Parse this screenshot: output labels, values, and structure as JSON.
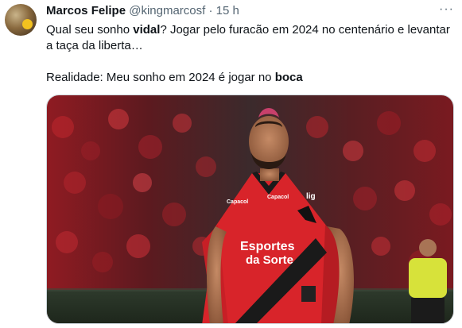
{
  "author": {
    "name": "Marcos Felipe",
    "handle": "@kingmarcosf",
    "separator": "·",
    "time": "15 h"
  },
  "more_icon": "more-horizontal-icon",
  "tweet": {
    "line1_pre": "Qual seu sonho ",
    "line1_bold": "vidal",
    "line1_post": "? Jogar pelo furacão em 2024 no centenário e levantar a taça da liberta…",
    "line2_pre": "Realidade: Meu sonho em 2024 é jogar no ",
    "line2_bold": "boca"
  },
  "media": {
    "jersey_sponsor_top": "Esportes",
    "jersey_sponsor_bottom": "da Sorte",
    "jersey_brand_left": "Capacol",
    "jersey_brand_right": "Capacol",
    "jersey_sleeve": "lig",
    "colors": {
      "jersey_red": "#d8242a",
      "jersey_black": "#1a1a1a",
      "crowd_red": "#b8202a"
    }
  }
}
